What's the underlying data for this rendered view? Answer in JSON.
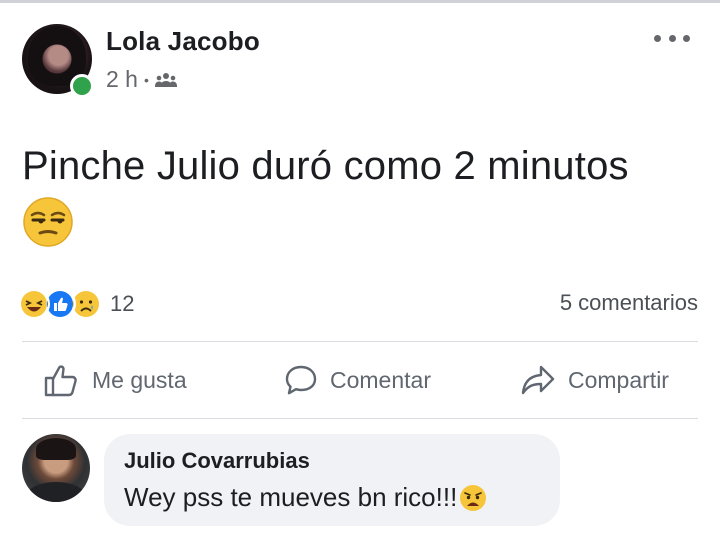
{
  "post": {
    "author": "Lola Jacobo",
    "time": "2 h",
    "separator": "•",
    "audience_icon": "friends-icon",
    "more_icon": "more-options-icon",
    "text": "Pinche Julio duró como 2 minutos",
    "emoji_icon": "unamused-face-icon"
  },
  "stats": {
    "reaction_icons": [
      "haha-icon",
      "like-icon",
      "sad-icon"
    ],
    "reactions_count": "12",
    "comments_label": "5 comentarios"
  },
  "actions": {
    "like_label": "Me gusta",
    "comment_label": "Comentar",
    "share_label": "Compartir"
  },
  "comment": {
    "author": "Julio Covarrubias",
    "text": "Wey pss te mueves bn rico!!!",
    "emoji_icon": "anguished-face-icon"
  },
  "colors": {
    "online": "#31a24c",
    "like_blue": "#1877f2",
    "emoji_yellow": "#f7c53a",
    "muted_text": "#65676b",
    "bubble_bg": "#f0f2f5"
  }
}
